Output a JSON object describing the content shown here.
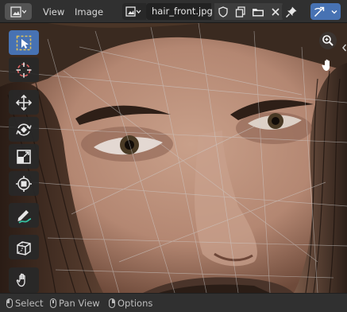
{
  "header": {
    "editor_type_icon": "image-editor-icon",
    "menus": [
      "View",
      "Image"
    ],
    "image_browse_icon": "image-browse-icon",
    "image_name": "hair_front.jpg",
    "fake_user_icon": "shield-icon",
    "duplicate_icon": "duplicate-icon",
    "open_icon": "folder-icon",
    "unlink_icon": "close-icon",
    "pin_icon": "pin-icon",
    "uv_sync_icon": "uv-sync-icon",
    "accent": "#4772b3"
  },
  "toolbar": {
    "tools": [
      {
        "name": "select-box",
        "icon": "select-box-icon",
        "active": true
      },
      {
        "name": "cursor",
        "icon": "cursor-icon",
        "active": false
      },
      {
        "name": "move",
        "icon": "move-icon",
        "active": false
      },
      {
        "name": "rotate",
        "icon": "rotate-icon",
        "active": false
      },
      {
        "name": "scale",
        "icon": "scale-icon",
        "active": false
      },
      {
        "name": "transform",
        "icon": "transform-icon",
        "active": false
      },
      {
        "name": "annotate",
        "icon": "annotate-icon",
        "active": false
      },
      {
        "name": "grab",
        "icon": "grab-icon",
        "active": false
      },
      {
        "name": "sample",
        "icon": "hand-icon",
        "active": false
      }
    ]
  },
  "navigation": {
    "zoom_icon": "zoom-icon",
    "pan_icon": "hand-icon",
    "collapse_icon": "chevron-left-icon"
  },
  "status": {
    "items": [
      {
        "mouse": "left",
        "label": "Select"
      },
      {
        "mouse": "middle",
        "label": "Pan View"
      },
      {
        "mouse": "right",
        "label": "Options"
      }
    ]
  }
}
